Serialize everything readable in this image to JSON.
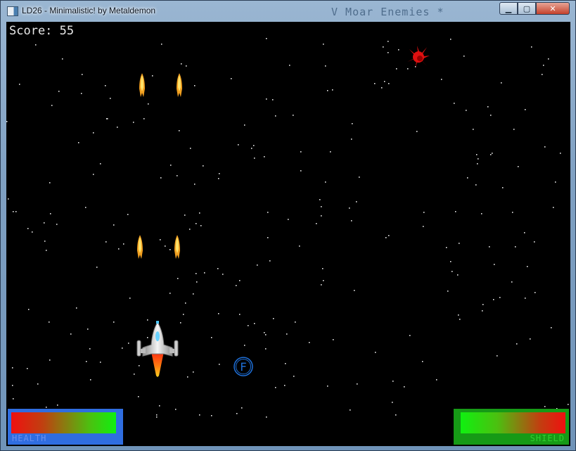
{
  "window": {
    "title": "LD26 - Minimalistic! by Metaldemon",
    "background_title": "V Moar Enemies *",
    "minimize_label": "▁",
    "maximize_label": "▢",
    "close_label": "✕"
  },
  "hud": {
    "score_text": "Score: 55",
    "health_label": "HEALTH",
    "shield_label": "SHIELD",
    "health_level": 0.97,
    "shield_level": 0.97
  },
  "powerup": {
    "letter": "F",
    "color": "#1e6fd8"
  },
  "colors": {
    "health_frame": "#2f6de0",
    "shield_frame": "#169a16",
    "bullet": "#ffcc33",
    "enemy": "#e01010",
    "background": "#000000"
  },
  "icons": {
    "player": "player-ship-icon",
    "enemy": "enemy-splat-icon",
    "bullet": "bullet-icon",
    "powerup": "powerup-f-icon"
  }
}
